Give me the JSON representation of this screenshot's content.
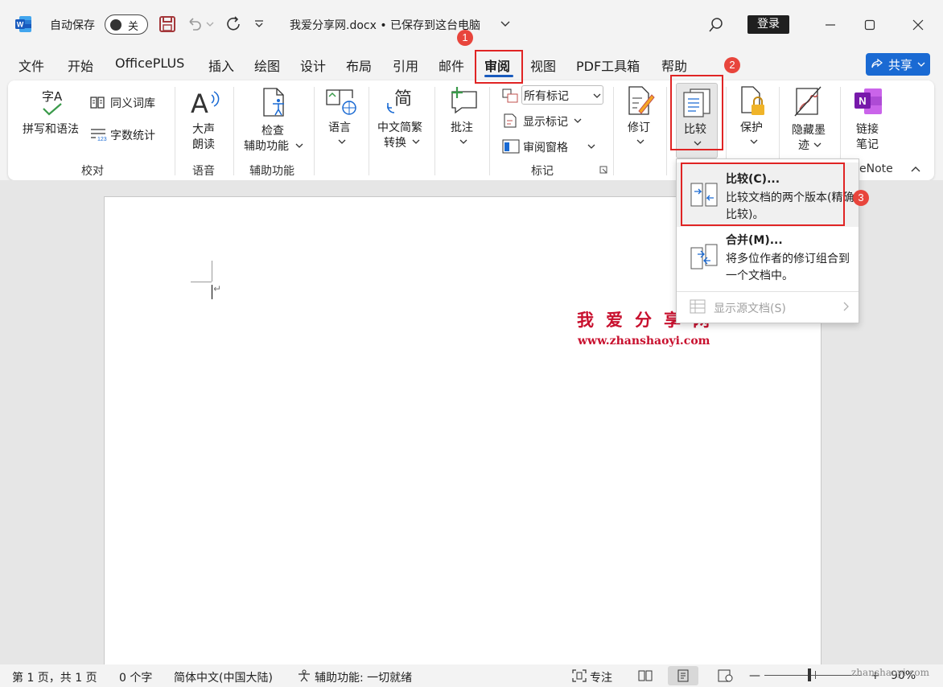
{
  "titlebar": {
    "autosave_label": "自动保存",
    "autosave_state": "关",
    "doc_title": "我爱分享网.docx • 已保存到这台电脑",
    "login": "登录"
  },
  "tabs": [
    {
      "label": "文件"
    },
    {
      "label": "开始"
    },
    {
      "label": "OfficePLUS"
    },
    {
      "label": "插入"
    },
    {
      "label": "绘图"
    },
    {
      "label": "设计"
    },
    {
      "label": "布局"
    },
    {
      "label": "引用"
    },
    {
      "label": "邮件"
    },
    {
      "label": "审阅"
    },
    {
      "label": "视图"
    },
    {
      "label": "PDF工具箱"
    },
    {
      "label": "帮助"
    }
  ],
  "share": "共享",
  "ribbon": {
    "spelling": "拼写和语法",
    "thesaurus": "同义词库",
    "word_count": "字数统计",
    "group_proofing": "校对",
    "read_aloud_1": "大声",
    "read_aloud_2": "朗读",
    "group_speech": "语音",
    "accessibility_1": "检查",
    "accessibility_2": "辅助功能",
    "group_accessibility": "辅助功能",
    "language": "语言",
    "chinese_conv_1": "中文简繁",
    "chinese_conv_2": "转换",
    "comment": "批注",
    "all_markup": "所有标记",
    "show_markup": "显示标记",
    "review_pane": "审阅窗格",
    "group_tracking": "标记",
    "track_changes": "修订",
    "compare": "比较",
    "protect": "保护",
    "hide_ink_1": "隐藏墨",
    "hide_ink_2": "迹",
    "onenote_1": "链接",
    "onenote_2": "笔记",
    "group_onenote": "eNote",
    "letter_zi": "字A"
  },
  "compare_menu": {
    "compare_title": "比较(C)...",
    "compare_desc": "比较文档的两个版本(精确比较)。",
    "combine_title": "合并(M)...",
    "combine_desc": "将多位作者的修订组合到一个文档中。",
    "show_source": "显示源文档(S)"
  },
  "watermark": {
    "title": "我爱分享网",
    "url": "www.zhanshaoyi.com",
    "corner": "zhanshaoyi.com"
  },
  "badges": [
    "1",
    "2",
    "3"
  ],
  "statusbar": {
    "page": "第 1 页，共 1 页",
    "words": "0 个字",
    "language": "简体中文(中国大陆)",
    "accessibility": "辅助功能: 一切就绪",
    "focus": "专注",
    "zoom": "90%"
  },
  "colors": {
    "accent": "#185abd",
    "share": "#1a6ad3",
    "annotation": "#e02424"
  }
}
